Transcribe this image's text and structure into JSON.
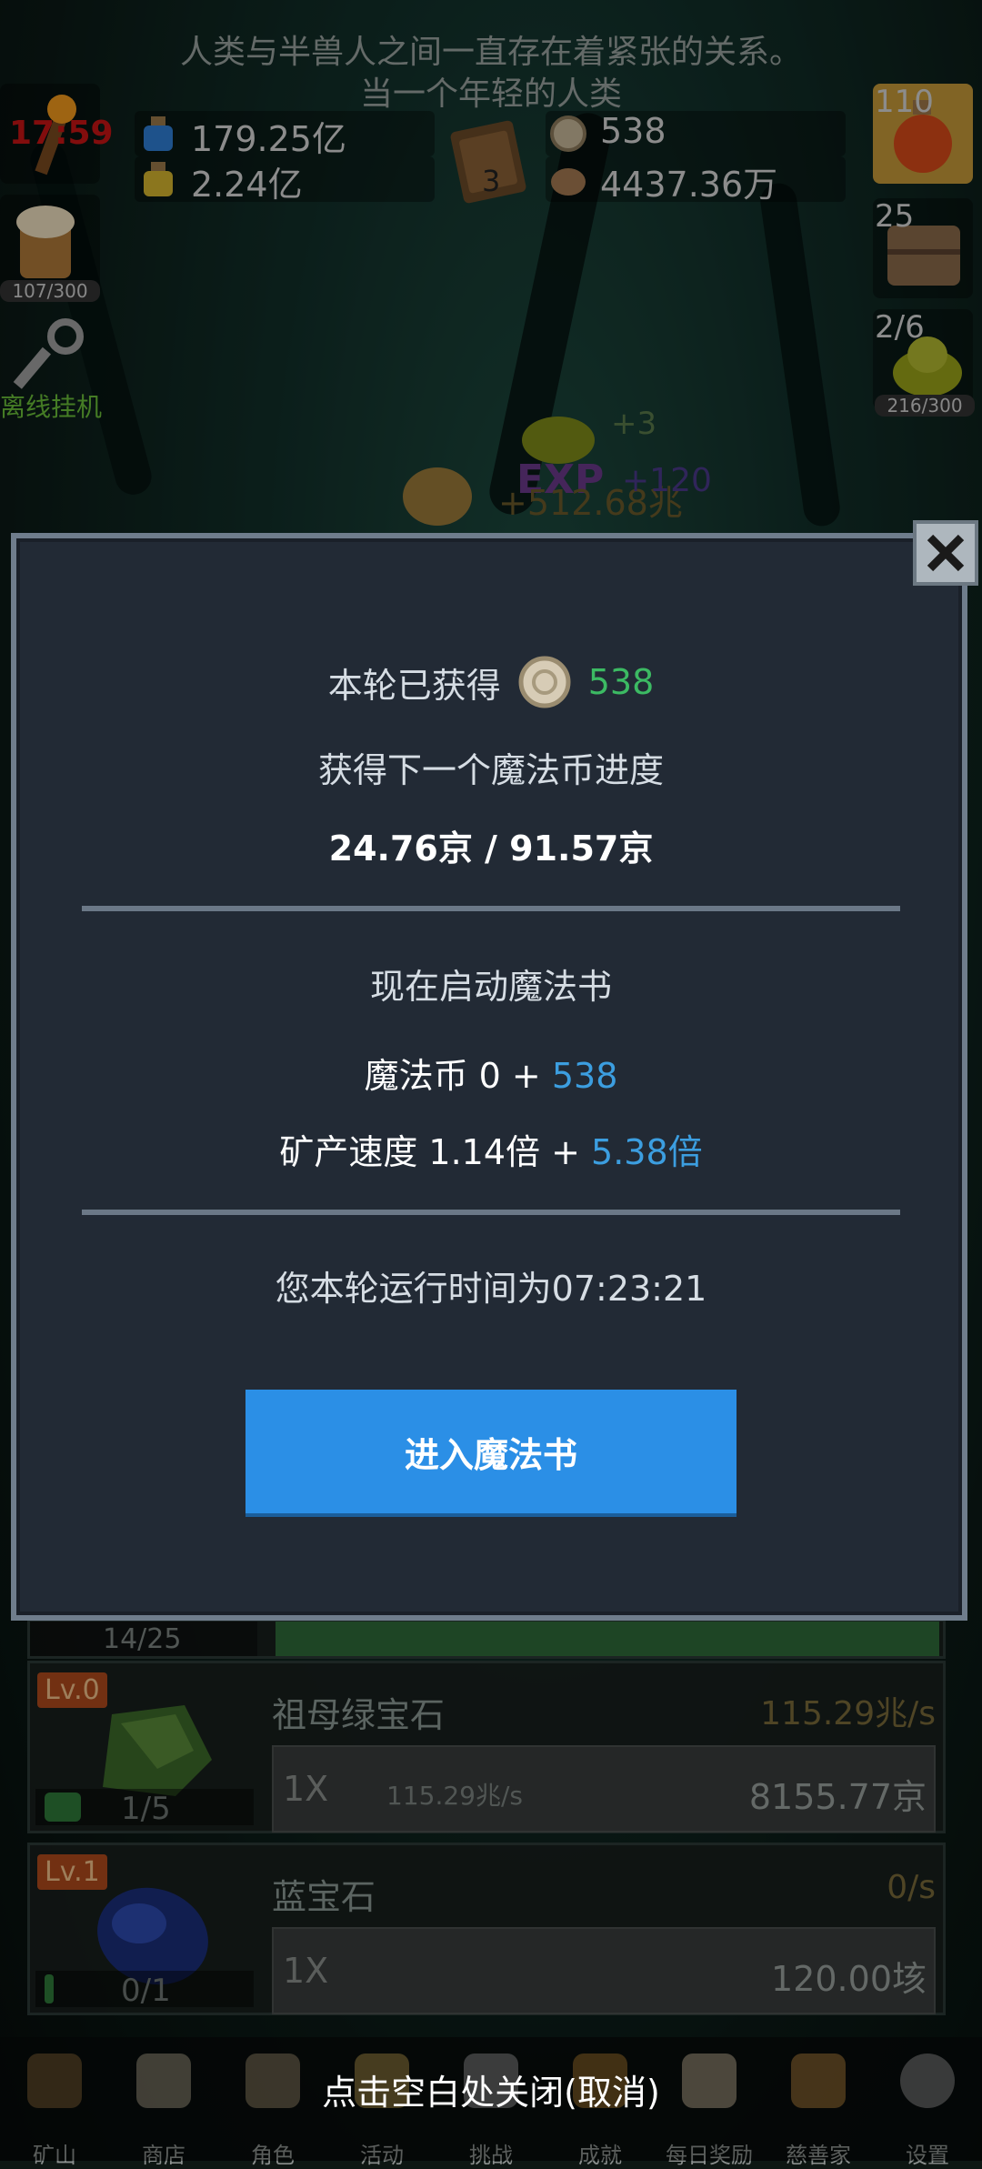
{
  "story": {
    "line1": "人类与半兽人之间一直存在着紧张的关系。",
    "line2": "当一个年轻的人类"
  },
  "hud": {
    "timer": "17:59",
    "blue_potion": "179.25亿",
    "yellow_potion": "2.24亿",
    "book_count": "3",
    "coin": "538",
    "ore": "4437.36万",
    "right_potion_count": "110",
    "chest_count": "25",
    "slime_count": "2/6",
    "slime_progress": "216/300",
    "beer_progress": "107/300",
    "offline_label": "离线挂机"
  },
  "floating": {
    "plus3": "+3",
    "exp": "EXP",
    "amount": "+512.68兆",
    "plus120": "+120"
  },
  "modal": {
    "earned_label": "本轮已获得",
    "earned_value": "538",
    "progress_label": "获得下一个魔法币进度",
    "progress_value": "24.76京 / 91.57京",
    "start_label": "现在启动魔法书",
    "magic_coin_base": "魔法币 0 + ",
    "magic_coin_add": "538",
    "speed_base": "矿产速度 1.14倍 + ",
    "speed_add": "5.38倍",
    "runtime": "您本轮运行时间为07:23:21",
    "enter_button": "进入魔法书"
  },
  "mines": [
    {
      "level": "Lv.0",
      "name": "祖母绿宝石",
      "rate": "115.29兆/s",
      "mult": "1X",
      "sub_rate": "115.29兆/s",
      "total": "8155.77京",
      "count": "1/5",
      "color": "#3d6b2a"
    },
    {
      "level": "Lv.1",
      "name": "蓝宝石",
      "rate": "0/s",
      "mult": "1X",
      "sub_rate": "",
      "total": "120.00垓",
      "count": "0/1",
      "color": "#1b2f7a"
    }
  ],
  "partial_row": {
    "count": "14/25"
  },
  "hint": "点击空白处关闭(取消)",
  "nav": [
    "矿山",
    "商店",
    "角色",
    "活动",
    "挑战",
    "成就",
    "每日奖励",
    "慈善家",
    "设置"
  ],
  "colors": {
    "modal_bg": "#222a35",
    "button_blue": "#2b8fe6",
    "accent_blue": "#3c9ee0",
    "accent_green": "#3cba63"
  }
}
